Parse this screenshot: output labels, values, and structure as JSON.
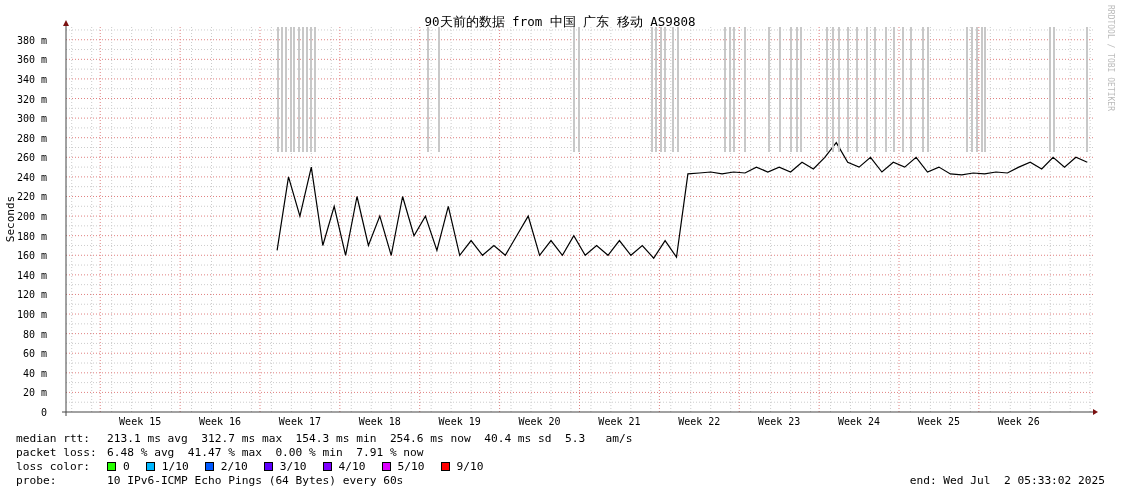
{
  "chart": {
    "credit": "RRDTOOL / TOBI OETIKER",
    "chart_data": {
      "type": "line",
      "grid": true,
      "title": "90天前的数据 from 中国 广东 移动 AS9808",
      "ylabel": "Seconds",
      "ylim": [
        0,
        393
      ],
      "categories": [
        null,
        null,
        null,
        null,
        null,
        null,
        "Week 15",
        null,
        null,
        null,
        null,
        null,
        null,
        "Week 16",
        null,
        null,
        null,
        null,
        null,
        null,
        "Week 17",
        null,
        null,
        null,
        null,
        null,
        null,
        "Week 18",
        null,
        null,
        null,
        null,
        null,
        null,
        "Week 19",
        null,
        null,
        null,
        null,
        null,
        null,
        "Week 20",
        null,
        null,
        null,
        null,
        null,
        null,
        "Week 21",
        null,
        null,
        null,
        null,
        null,
        null,
        "Week 22",
        null,
        null,
        null,
        null,
        null,
        null,
        "Week 23",
        null,
        null,
        null,
        null,
        null,
        null,
        "Week 24",
        null,
        null,
        null,
        null,
        null,
        null,
        "Week 25",
        null,
        null,
        null,
        null,
        null,
        null,
        "Week 26",
        null,
        null,
        null,
        null,
        null,
        null
      ],
      "series": [
        {
          "name": "median rtt:",
          "color": "#000000",
          "values": [
            null,
            null,
            null,
            null,
            null,
            null,
            null,
            null,
            null,
            null,
            null,
            null,
            null,
            null,
            null,
            null,
            null,
            null,
            165,
            240,
            200,
            250,
            170,
            210,
            160,
            220,
            170,
            200,
            160,
            220,
            180,
            200,
            165,
            210,
            160,
            175,
            160,
            170,
            160,
            180,
            200,
            160,
            175,
            160,
            180,
            160,
            170,
            160,
            175,
            160,
            170,
            157,
            175,
            158,
            243,
            244,
            245,
            243,
            245,
            244,
            250,
            245,
            250,
            245,
            255,
            248,
            260,
            275,
            255,
            250,
            260,
            245,
            255,
            250,
            260,
            245,
            250,
            243,
            242,
            244,
            243,
            245,
            244,
            250,
            255,
            248,
            260,
            250,
            260,
            255
          ]
        }
      ],
      "yticks": [
        {
          "value": 0,
          "label": "0"
        },
        {
          "value": 20,
          "label": "20 m"
        },
        {
          "value": 40,
          "label": "40 m"
        },
        {
          "value": 60,
          "label": "60 m"
        },
        {
          "value": 80,
          "label": "80 m"
        },
        {
          "value": 100,
          "label": "100 m"
        },
        {
          "value": 120,
          "label": "120 m"
        },
        {
          "value": 140,
          "label": "140 m"
        },
        {
          "value": 160,
          "label": "160 m"
        },
        {
          "value": 180,
          "label": "180 m"
        },
        {
          "value": 200,
          "label": "200 m"
        },
        {
          "value": 220,
          "label": "220 m"
        },
        {
          "value": 240,
          "label": "240 m"
        },
        {
          "value": 260,
          "label": "260 m"
        },
        {
          "value": 280,
          "label": "280 m"
        },
        {
          "value": 300,
          "label": "300 m"
        },
        {
          "value": 320,
          "label": "320 m"
        },
        {
          "value": 340,
          "label": "340 m"
        },
        {
          "value": 360,
          "label": "360 m"
        },
        {
          "value": 380,
          "label": "380 m"
        }
      ]
    }
  },
  "legend": {
    "stats": [
      {
        "text": "213.1 ms avg  312.7 ms max  154.3 ms min  254.6 ms now  40.4 ms sd  5.3   am/s"
      },
      {
        "label": "packet loss:",
        "text": "6.48 % avg  41.47 % max  0.00 % min  7.91 % now"
      }
    ],
    "loss_color": {
      "label": "loss color:",
      "items": [
        {
          "label": "0",
          "color": "#26ff00"
        },
        {
          "label": "1/10",
          "color": "#00b8ff"
        },
        {
          "label": "2/10",
          "color": "#0059ff"
        },
        {
          "label": "3/10",
          "color": "#5e00ff"
        },
        {
          "label": "4/10",
          "color": "#7e00ff"
        },
        {
          "label": "5/10",
          "color": "#dd00ff"
        },
        {
          "label": "9/10",
          "color": "#ff0000"
        }
      ]
    },
    "probe": {
      "label": "probe:",
      "text": "10 IPv6-ICMP Echo Pings (64 Bytes) every 60s"
    },
    "end": "end: Wed Jul  2 05:33:02 2025"
  }
}
